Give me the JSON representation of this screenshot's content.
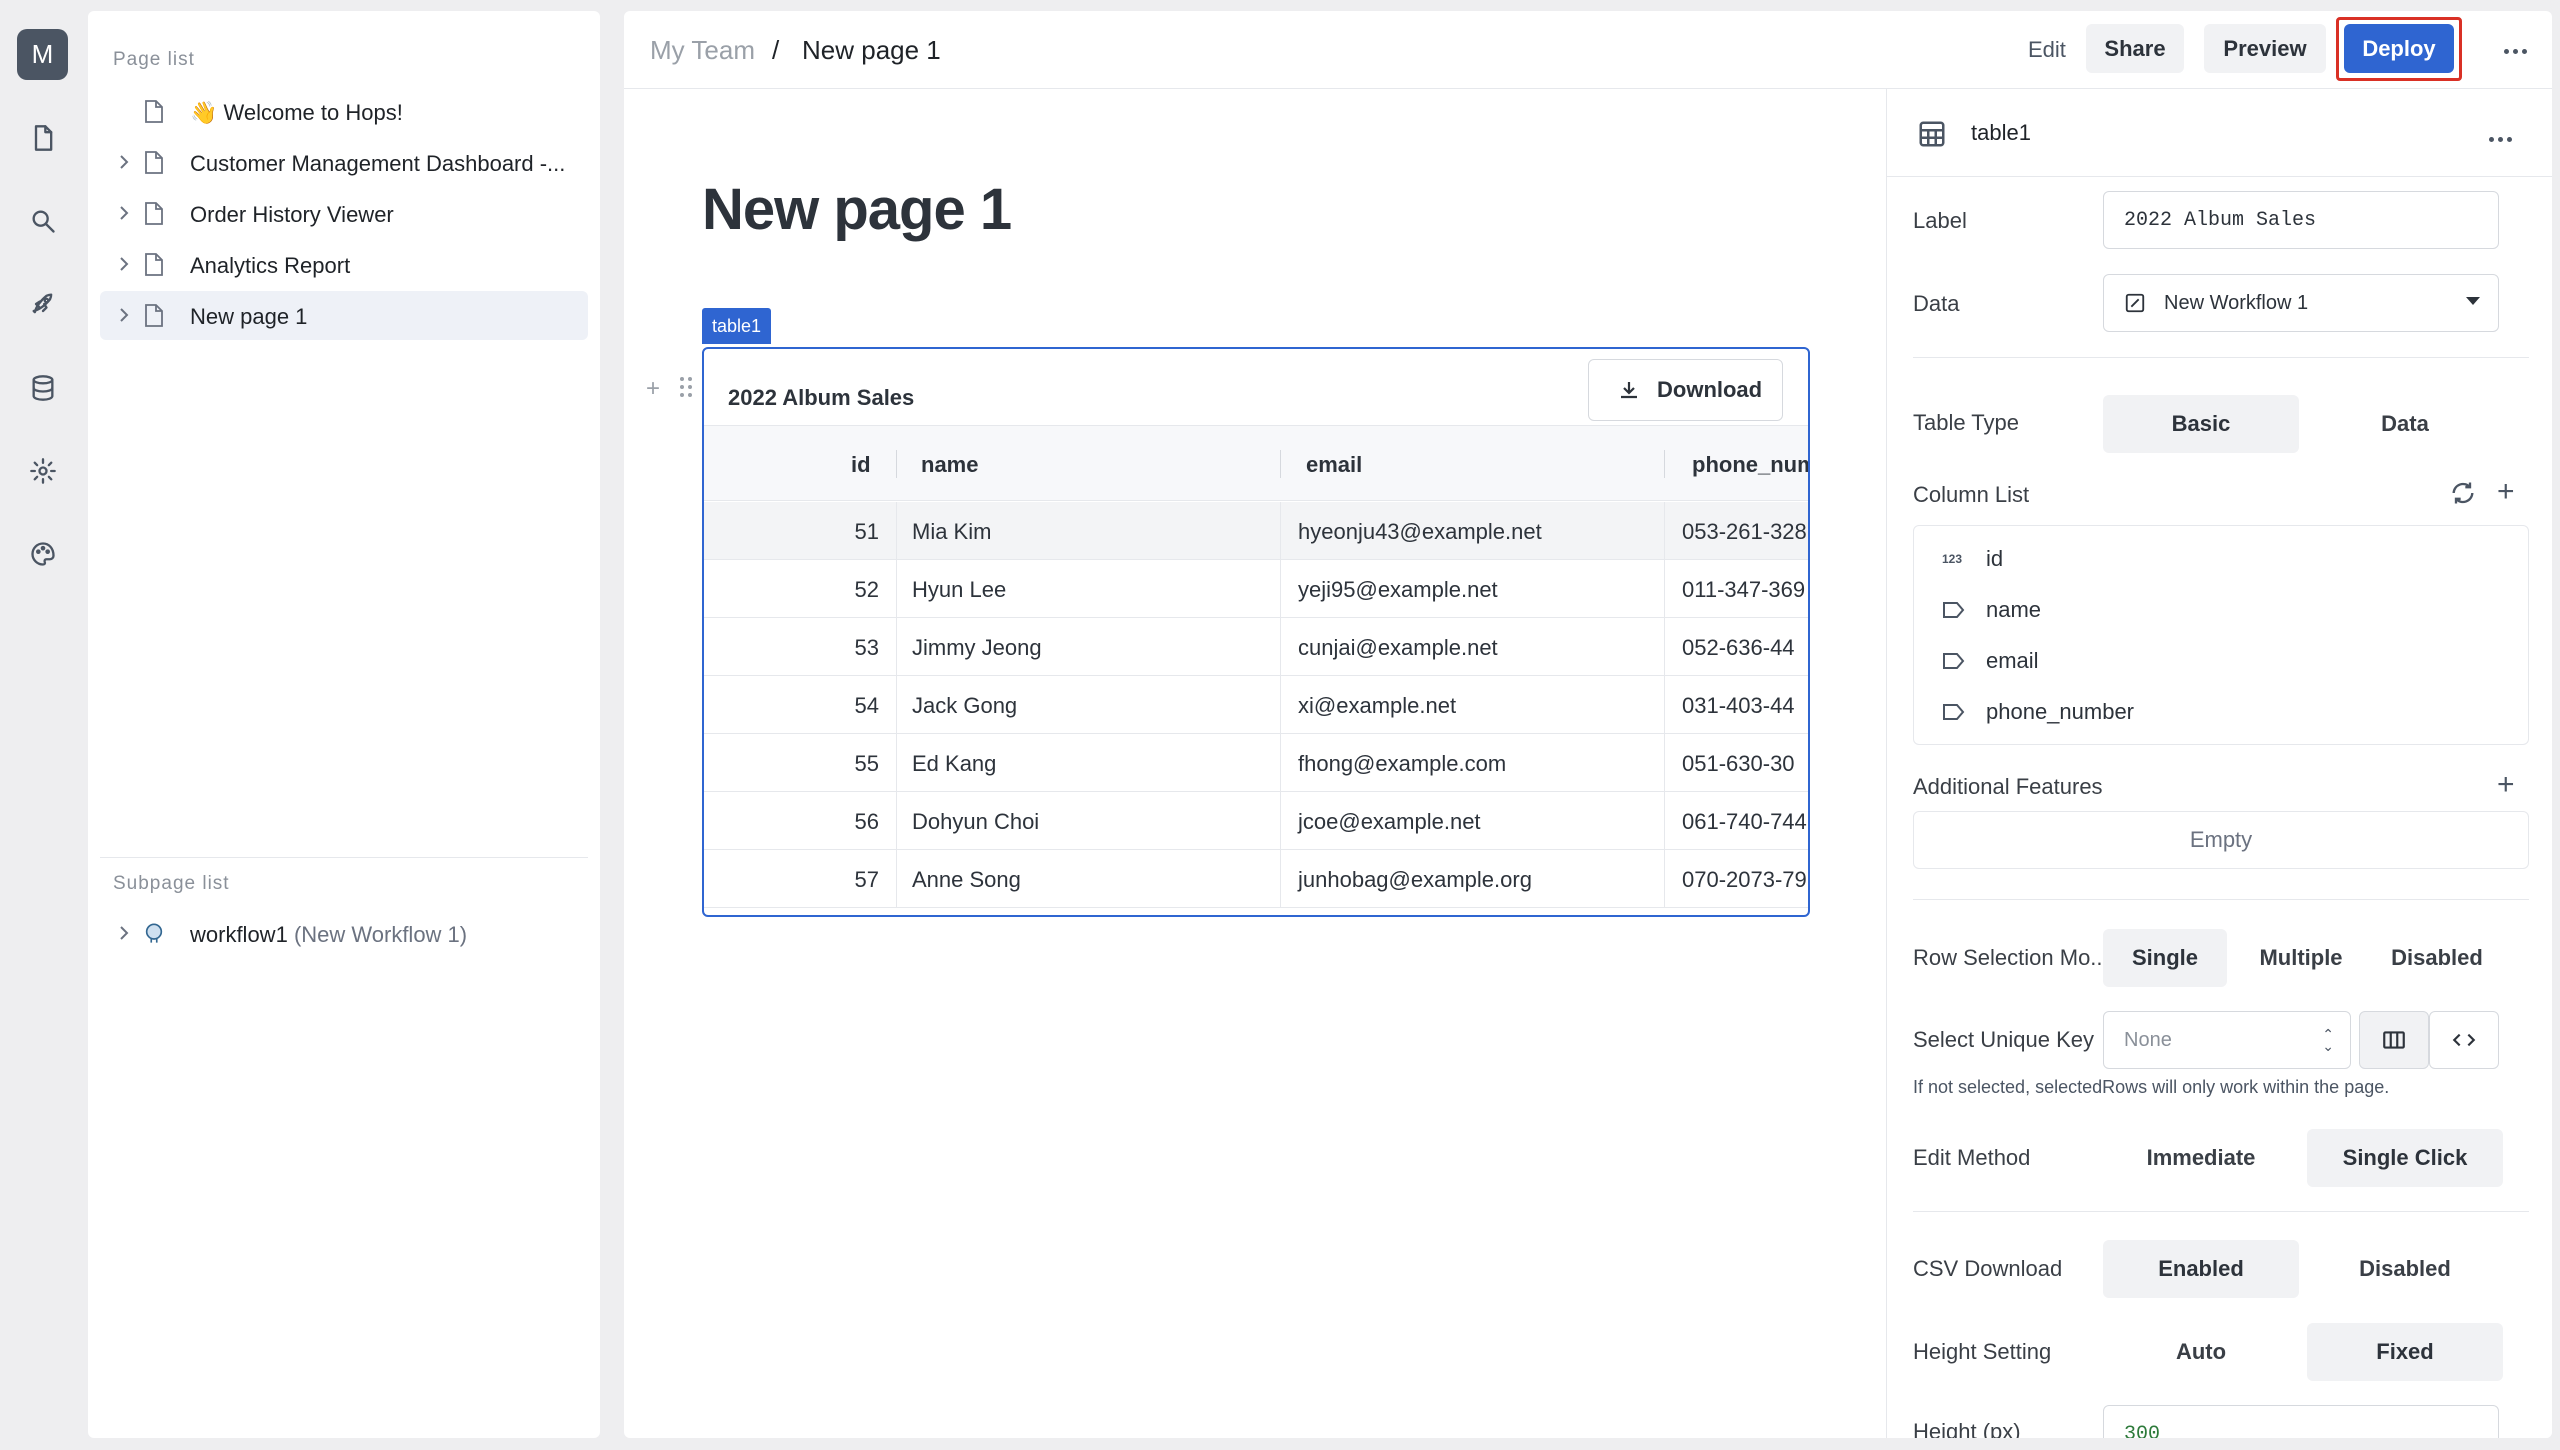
{
  "rail": {
    "avatar_letter": "M",
    "icons": [
      "document-icon",
      "search-icon",
      "rocket-icon",
      "database-icon",
      "gear-icon",
      "palette-icon"
    ]
  },
  "page_list": {
    "title": "Page list",
    "items": [
      {
        "label": "👋 Welcome to Hops!",
        "has_children": false,
        "active": false
      },
      {
        "label": "Customer Management Dashboard -...",
        "has_children": true,
        "active": false
      },
      {
        "label": "Order History Viewer",
        "has_children": true,
        "active": false
      },
      {
        "label": "Analytics Report",
        "has_children": true,
        "active": false
      },
      {
        "label": "New page 1",
        "has_children": true,
        "active": true
      }
    ]
  },
  "subpage_list": {
    "title": "Subpage list",
    "items": [
      {
        "label": "workflow1",
        "sub": "(New Workflow 1)"
      }
    ]
  },
  "breadcrumb": {
    "team": "My Team",
    "separator": "/",
    "page": "New page 1"
  },
  "toolbar": {
    "edit": "Edit",
    "share": "Share",
    "preview": "Preview",
    "deploy": "Deploy"
  },
  "page": {
    "heading": "New page 1"
  },
  "table_widget": {
    "tag": "table1",
    "title": "2022 Album Sales",
    "download_label": "Download",
    "columns": [
      "id",
      "name",
      "email",
      "phone_num"
    ],
    "rows": [
      {
        "id": "51",
        "name": "Mia Kim",
        "email": "hyeonju43@example.net",
        "phone": "053-261-328"
      },
      {
        "id": "52",
        "name": "Hyun Lee",
        "email": "yeji95@example.net",
        "phone": "011-347-369"
      },
      {
        "id": "53",
        "name": "Jimmy Jeong",
        "email": "cunjai@example.net",
        "phone": "052-636-44"
      },
      {
        "id": "54",
        "name": "Jack Gong",
        "email": "xi@example.net",
        "phone": "031-403-44"
      },
      {
        "id": "55",
        "name": "Ed Kang",
        "email": "fhong@example.com",
        "phone": "051-630-30"
      },
      {
        "id": "56",
        "name": "Dohyun Choi",
        "email": "jcoe@example.net",
        "phone": "061-740-744"
      },
      {
        "id": "57",
        "name": "Anne Song",
        "email": "junhobag@example.org",
        "phone": "070-2073-79"
      }
    ]
  },
  "props": {
    "component_name": "table1",
    "label_label": "Label",
    "label_value": "2022 Album Sales",
    "data_label": "Data",
    "data_value": "New Workflow 1",
    "table_type_label": "Table Type",
    "table_type_options": [
      "Basic",
      "Data"
    ],
    "column_list_label": "Column List",
    "columns": [
      {
        "type": "123",
        "name": "id"
      },
      {
        "type": "tag",
        "name": "name"
      },
      {
        "type": "tag",
        "name": "email"
      },
      {
        "type": "tag",
        "name": "phone_number"
      }
    ],
    "additional_features_label": "Additional Features",
    "additional_features_value": "Empty",
    "row_selection_label": "Row Selection Mo...",
    "row_selection_options": [
      "Single",
      "Multiple",
      "Disabled"
    ],
    "unique_key_label": "Select Unique Key",
    "unique_key_value": "None",
    "unique_key_hint": "If not selected, selectedRows will only work within the page.",
    "edit_method_label": "Edit Method",
    "edit_method_options": [
      "Immediate",
      "Single Click"
    ],
    "csv_label": "CSV Download",
    "csv_options": [
      "Enabled",
      "Disabled"
    ],
    "height_setting_label": "Height Setting",
    "height_setting_options": [
      "Auto",
      "Fixed"
    ],
    "height_px_label": "Height (px)",
    "height_px_value": "300"
  },
  "colors": {
    "accent": "#2f65d1",
    "highlight": "#d93025"
  }
}
